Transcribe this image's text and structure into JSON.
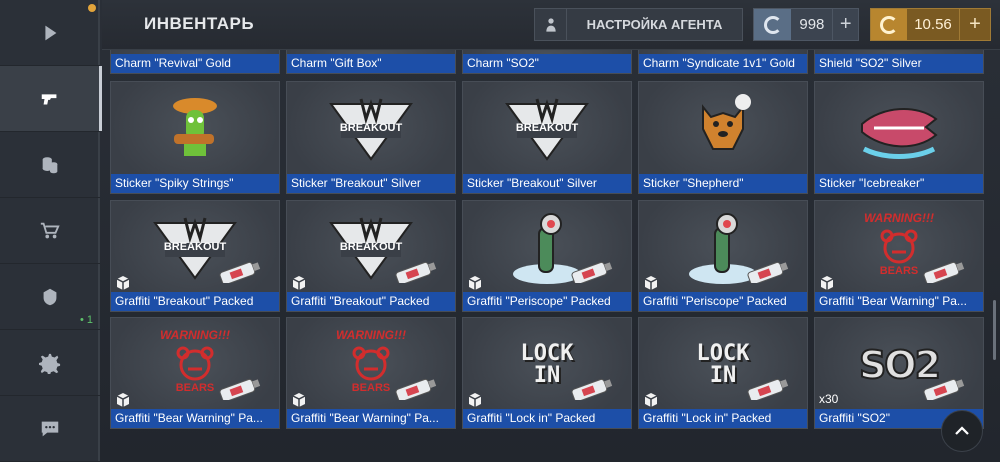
{
  "header": {
    "title": "ИНВЕНТАРЬ",
    "agent_button_label": "НАСТРОЙКА АГЕНТА",
    "credits_value": "998",
    "gold_value": "10.56",
    "credits_color": "#5a6e86",
    "gold_color": "#b8862f"
  },
  "sidebar": {
    "items": [
      {
        "icon": "play-icon"
      },
      {
        "icon": "pistol-icon",
        "active": true
      },
      {
        "icon": "coins-icon"
      },
      {
        "icon": "cart-icon"
      },
      {
        "icon": "clan-icon",
        "badge": "• 1"
      },
      {
        "icon": "gear-icon"
      },
      {
        "icon": "chat-icon"
      }
    ]
  },
  "inventory": {
    "rows": [
      [
        {
          "name": "Charm \"Revival\" Gold"
        },
        {
          "name": "Charm \"Gift Box\""
        },
        {
          "name": "Charm \"SO2\""
        },
        {
          "name": "Charm \"Syndicate 1v1\" Gold"
        },
        {
          "name": "Shield \"SO2\" Silver"
        }
      ],
      [
        {
          "name": "Sticker \"Spiky Strings\""
        },
        {
          "name": "Sticker \"Breakout\" Silver"
        },
        {
          "name": "Sticker \"Breakout\" Silver"
        },
        {
          "name": "Sticker \"Shepherd\""
        },
        {
          "name": "Sticker \"Icebreaker\""
        }
      ],
      [
        {
          "name": "Graffiti \"Breakout\" Packed"
        },
        {
          "name": "Graffiti \"Breakout\" Packed"
        },
        {
          "name": "Graffiti \"Periscope\" Packed"
        },
        {
          "name": "Graffiti \"Periscope\" Packed"
        },
        {
          "name": "Graffiti \"Bear Warning\" Pa..."
        }
      ],
      [
        {
          "name": "Graffiti \"Bear Warning\" Pa..."
        },
        {
          "name": "Graffiti \"Bear Warning\" Pa..."
        },
        {
          "name": "Graffiti \"Lock in\" Packed"
        },
        {
          "name": "Graffiti \"Lock in\" Packed"
        },
        {
          "name": "Graffiti \"SO2\"",
          "qty": "x30"
        }
      ]
    ],
    "art_text": {
      "breakout": "BREAKOUT",
      "lock_in_line1": "LOCK",
      "lock_in_line2": "IN",
      "so2": "SO2",
      "warning": "WARNING!!!",
      "bears": "BEARS"
    }
  }
}
